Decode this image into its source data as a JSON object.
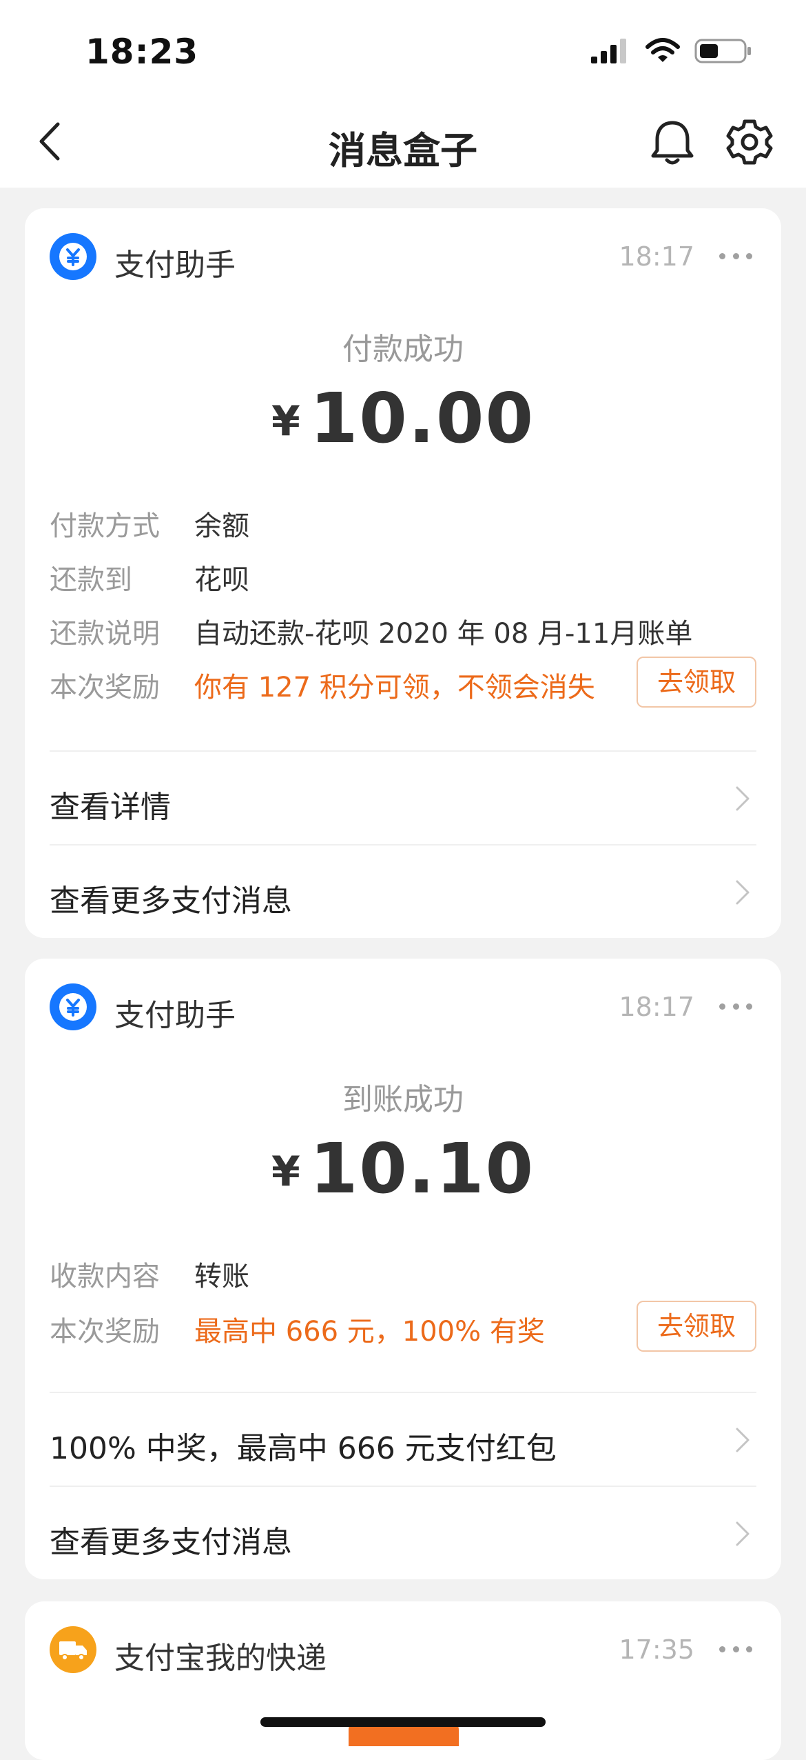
{
  "status_bar": {
    "time": "18:23"
  },
  "nav": {
    "title": "消息盒子"
  },
  "cards": [
    {
      "app_name": "支付助手",
      "time": "18:17",
      "status_title": "付款成功",
      "currency": "¥",
      "amount": "10.00",
      "details": [
        {
          "key": "付款方式",
          "value": "余额"
        },
        {
          "key": "还款到",
          "value": "花呗"
        },
        {
          "key": "还款说明",
          "value": "自动还款-花呗 2020 年 08 月-11月账单"
        },
        {
          "key": "本次奖励",
          "value": "你有 127 积分可领，不领会消失",
          "button": "去领取"
        }
      ],
      "rows": [
        "查看详情",
        "查看更多支付消息"
      ]
    },
    {
      "app_name": "支付助手",
      "time": "18:17",
      "status_title": "到账成功",
      "currency": "¥",
      "amount": "10.10",
      "details": [
        {
          "key": "收款内容",
          "value": "转账"
        },
        {
          "key": "本次奖励",
          "value": "最高中 666 元，100% 有奖",
          "button": "去领取"
        }
      ],
      "rows": [
        "100% 中奖，最高中 666 元支付红包",
        "查看更多支付消息"
      ]
    },
    {
      "app_name": "支付宝我的快递",
      "time": "17:35"
    }
  ],
  "colors": {
    "accent_orange": "#ec6a1a",
    "alipay_blue": "#1677ff",
    "express_orange": "#f7a21b"
  }
}
